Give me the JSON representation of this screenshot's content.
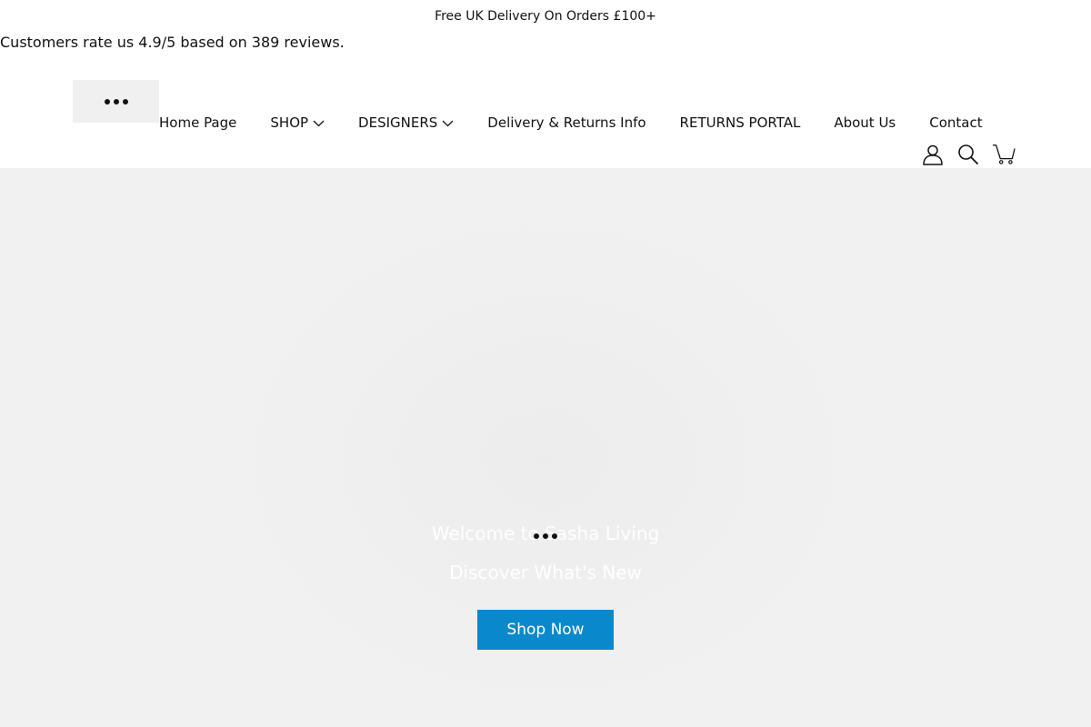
{
  "announcement": {
    "text": "Free UK Delivery On Orders £100+"
  },
  "reviews": {
    "text": "Customers rate us 4.9/5 based on 389 reviews."
  },
  "nav": {
    "items": [
      {
        "label": "Home Page",
        "has_dropdown": false
      },
      {
        "label": "SHOP",
        "has_dropdown": true
      },
      {
        "label": "DESIGNERS",
        "has_dropdown": true
      },
      {
        "label": "Delivery & Returns Info",
        "has_dropdown": false
      },
      {
        "label": "RETURNS PORTAL",
        "has_dropdown": false
      },
      {
        "label": "About Us",
        "has_dropdown": false
      },
      {
        "label": "Contact",
        "has_dropdown": false
      }
    ]
  },
  "header_icons": [
    "account-icon",
    "search-icon",
    "cart-icon"
  ],
  "hero": {
    "title": "Welcome to Sasha Living",
    "subtitle": "Discover What's New",
    "button_label": "Shop Now",
    "button_color": "#0a88cc",
    "background_color": "#f1f1f1"
  }
}
